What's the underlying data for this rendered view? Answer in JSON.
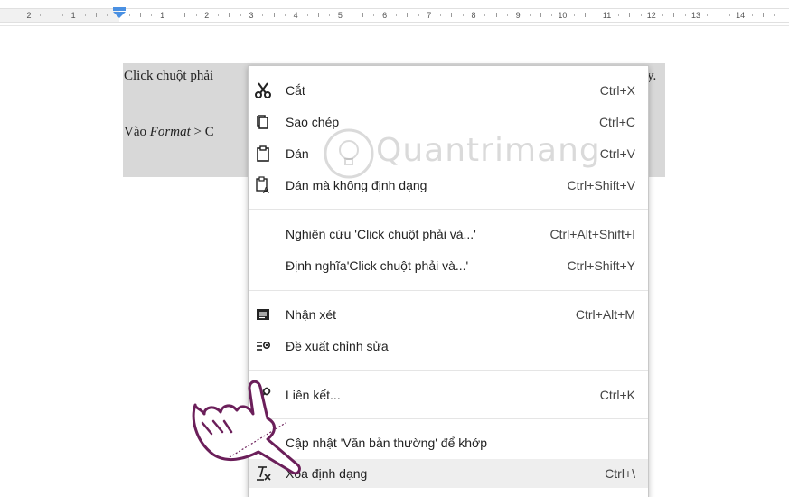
{
  "ruler": {
    "numbers": [
      "2",
      "1",
      "",
      "1",
      "2",
      "3",
      "4",
      "5",
      "6",
      "7",
      "8",
      "9",
      "10",
      "11",
      "12",
      "13",
      "14"
    ]
  },
  "document": {
    "line1_text": "Click chuột phải",
    "line1_end": "y.",
    "line2_prefix": "Vào ",
    "line2_italic": "Format",
    "line2_suffix": " > C"
  },
  "watermark": {
    "text": "Quantrimang"
  },
  "menu": {
    "items": [
      {
        "label": "Cắt",
        "shortcut": "Ctrl+X",
        "icon": "scissors-icon"
      },
      {
        "label": "Sao chép",
        "shortcut": "Ctrl+C",
        "icon": "copy-icon"
      },
      {
        "label": "Dán",
        "shortcut": "Ctrl+V",
        "icon": "paste-icon"
      },
      {
        "label": "Dán mà không định dạng",
        "shortcut": "Ctrl+Shift+V",
        "icon": "paste-plain-icon"
      },
      {
        "label": "Nghiên cứu 'Click chuột phải và...'",
        "shortcut": "Ctrl+Alt+Shift+I",
        "icon": ""
      },
      {
        "label": "Định nghĩa'Click chuột phải và...'",
        "shortcut": "Ctrl+Shift+Y",
        "icon": ""
      },
      {
        "label": "Nhận xét",
        "shortcut": "Ctrl+Alt+M",
        "icon": "comment-icon"
      },
      {
        "label": "Đề xuất chỉnh sửa",
        "shortcut": "",
        "icon": "suggest-edit-icon"
      },
      {
        "label": "Liên kết...",
        "shortcut": "Ctrl+K",
        "icon": "link-icon"
      },
      {
        "label": "Cập nhật 'Văn bản thường' để khớp",
        "shortcut": "",
        "icon": ""
      },
      {
        "label": "Xóa định dạng",
        "shortcut": "Ctrl+\\",
        "icon": "clear-formatting-icon"
      }
    ]
  },
  "colors": {
    "selection": "#d8d8d8",
    "menu_hover": "#eeeeee",
    "hand_outline": "#6b1f5a"
  }
}
